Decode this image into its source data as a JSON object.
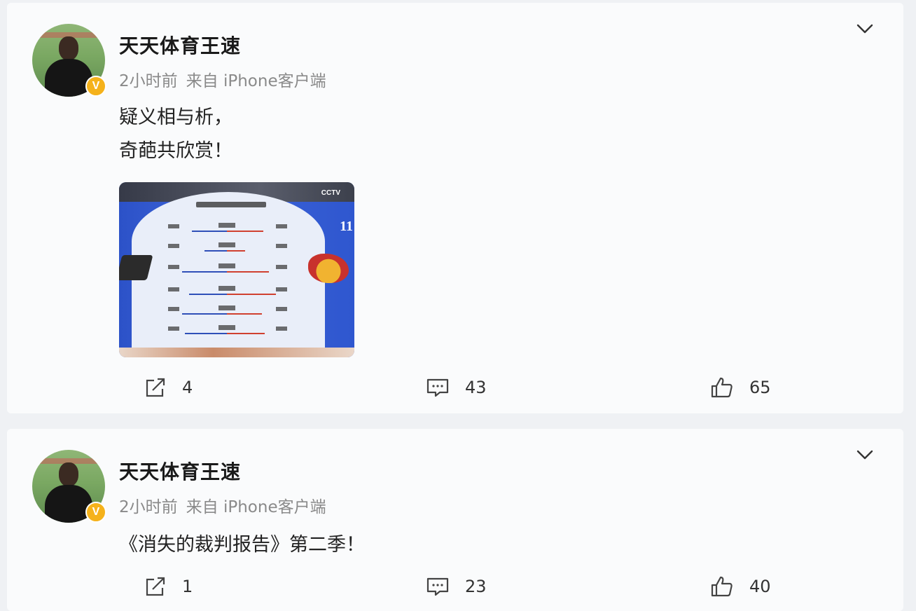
{
  "posts": [
    {
      "author": "天天体育王速",
      "verified_badge": "V",
      "time": "2小时前",
      "source": "来自 iPhone客户端",
      "lines": [
        "疑义相与析，",
        "奇葩共欣赏！"
      ],
      "image_icon": "tv-stats-screenshot",
      "shares": "4",
      "comments": "43",
      "likes": "65"
    },
    {
      "author": "天天体育王速",
      "verified_badge": "V",
      "time": "2小时前",
      "source": "来自 iPhone客户端",
      "lines": [
        "《消失的裁判报告》第二季！"
      ],
      "shares": "1",
      "comments": "23",
      "likes": "40"
    }
  ],
  "icons": {
    "menu": "chevron-down-icon",
    "share": "share-icon",
    "comment": "comment-icon",
    "like": "thumbs-up-icon"
  },
  "colors": {
    "badge": "#f5b21b",
    "meta_text": "#8a8a8a"
  }
}
